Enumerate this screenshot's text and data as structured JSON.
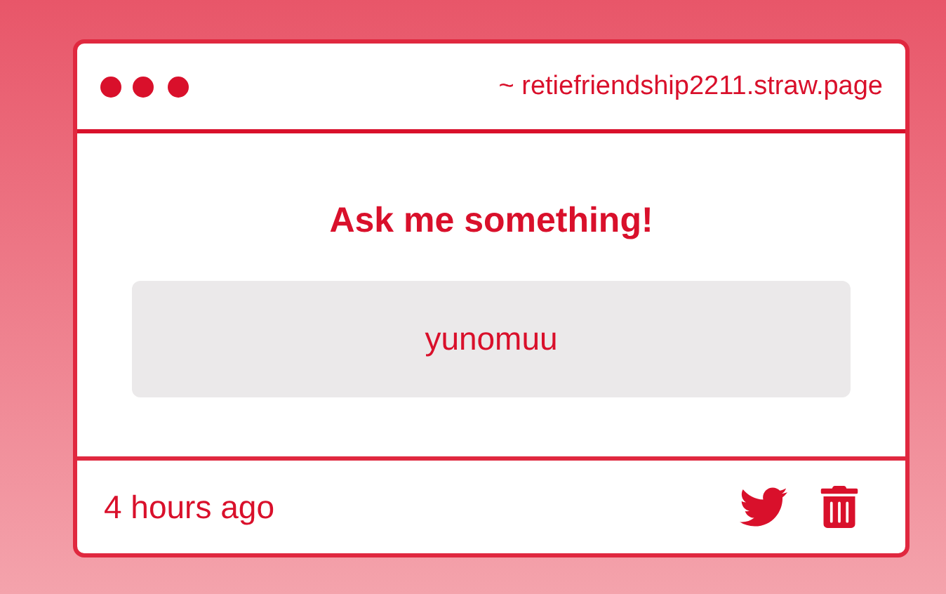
{
  "window": {
    "title": "~ retiefriendship2211.straw.page"
  },
  "question": {
    "title": "Ask me something!",
    "answer": "yunomuu"
  },
  "footer": {
    "time": "4 hours ago"
  }
}
